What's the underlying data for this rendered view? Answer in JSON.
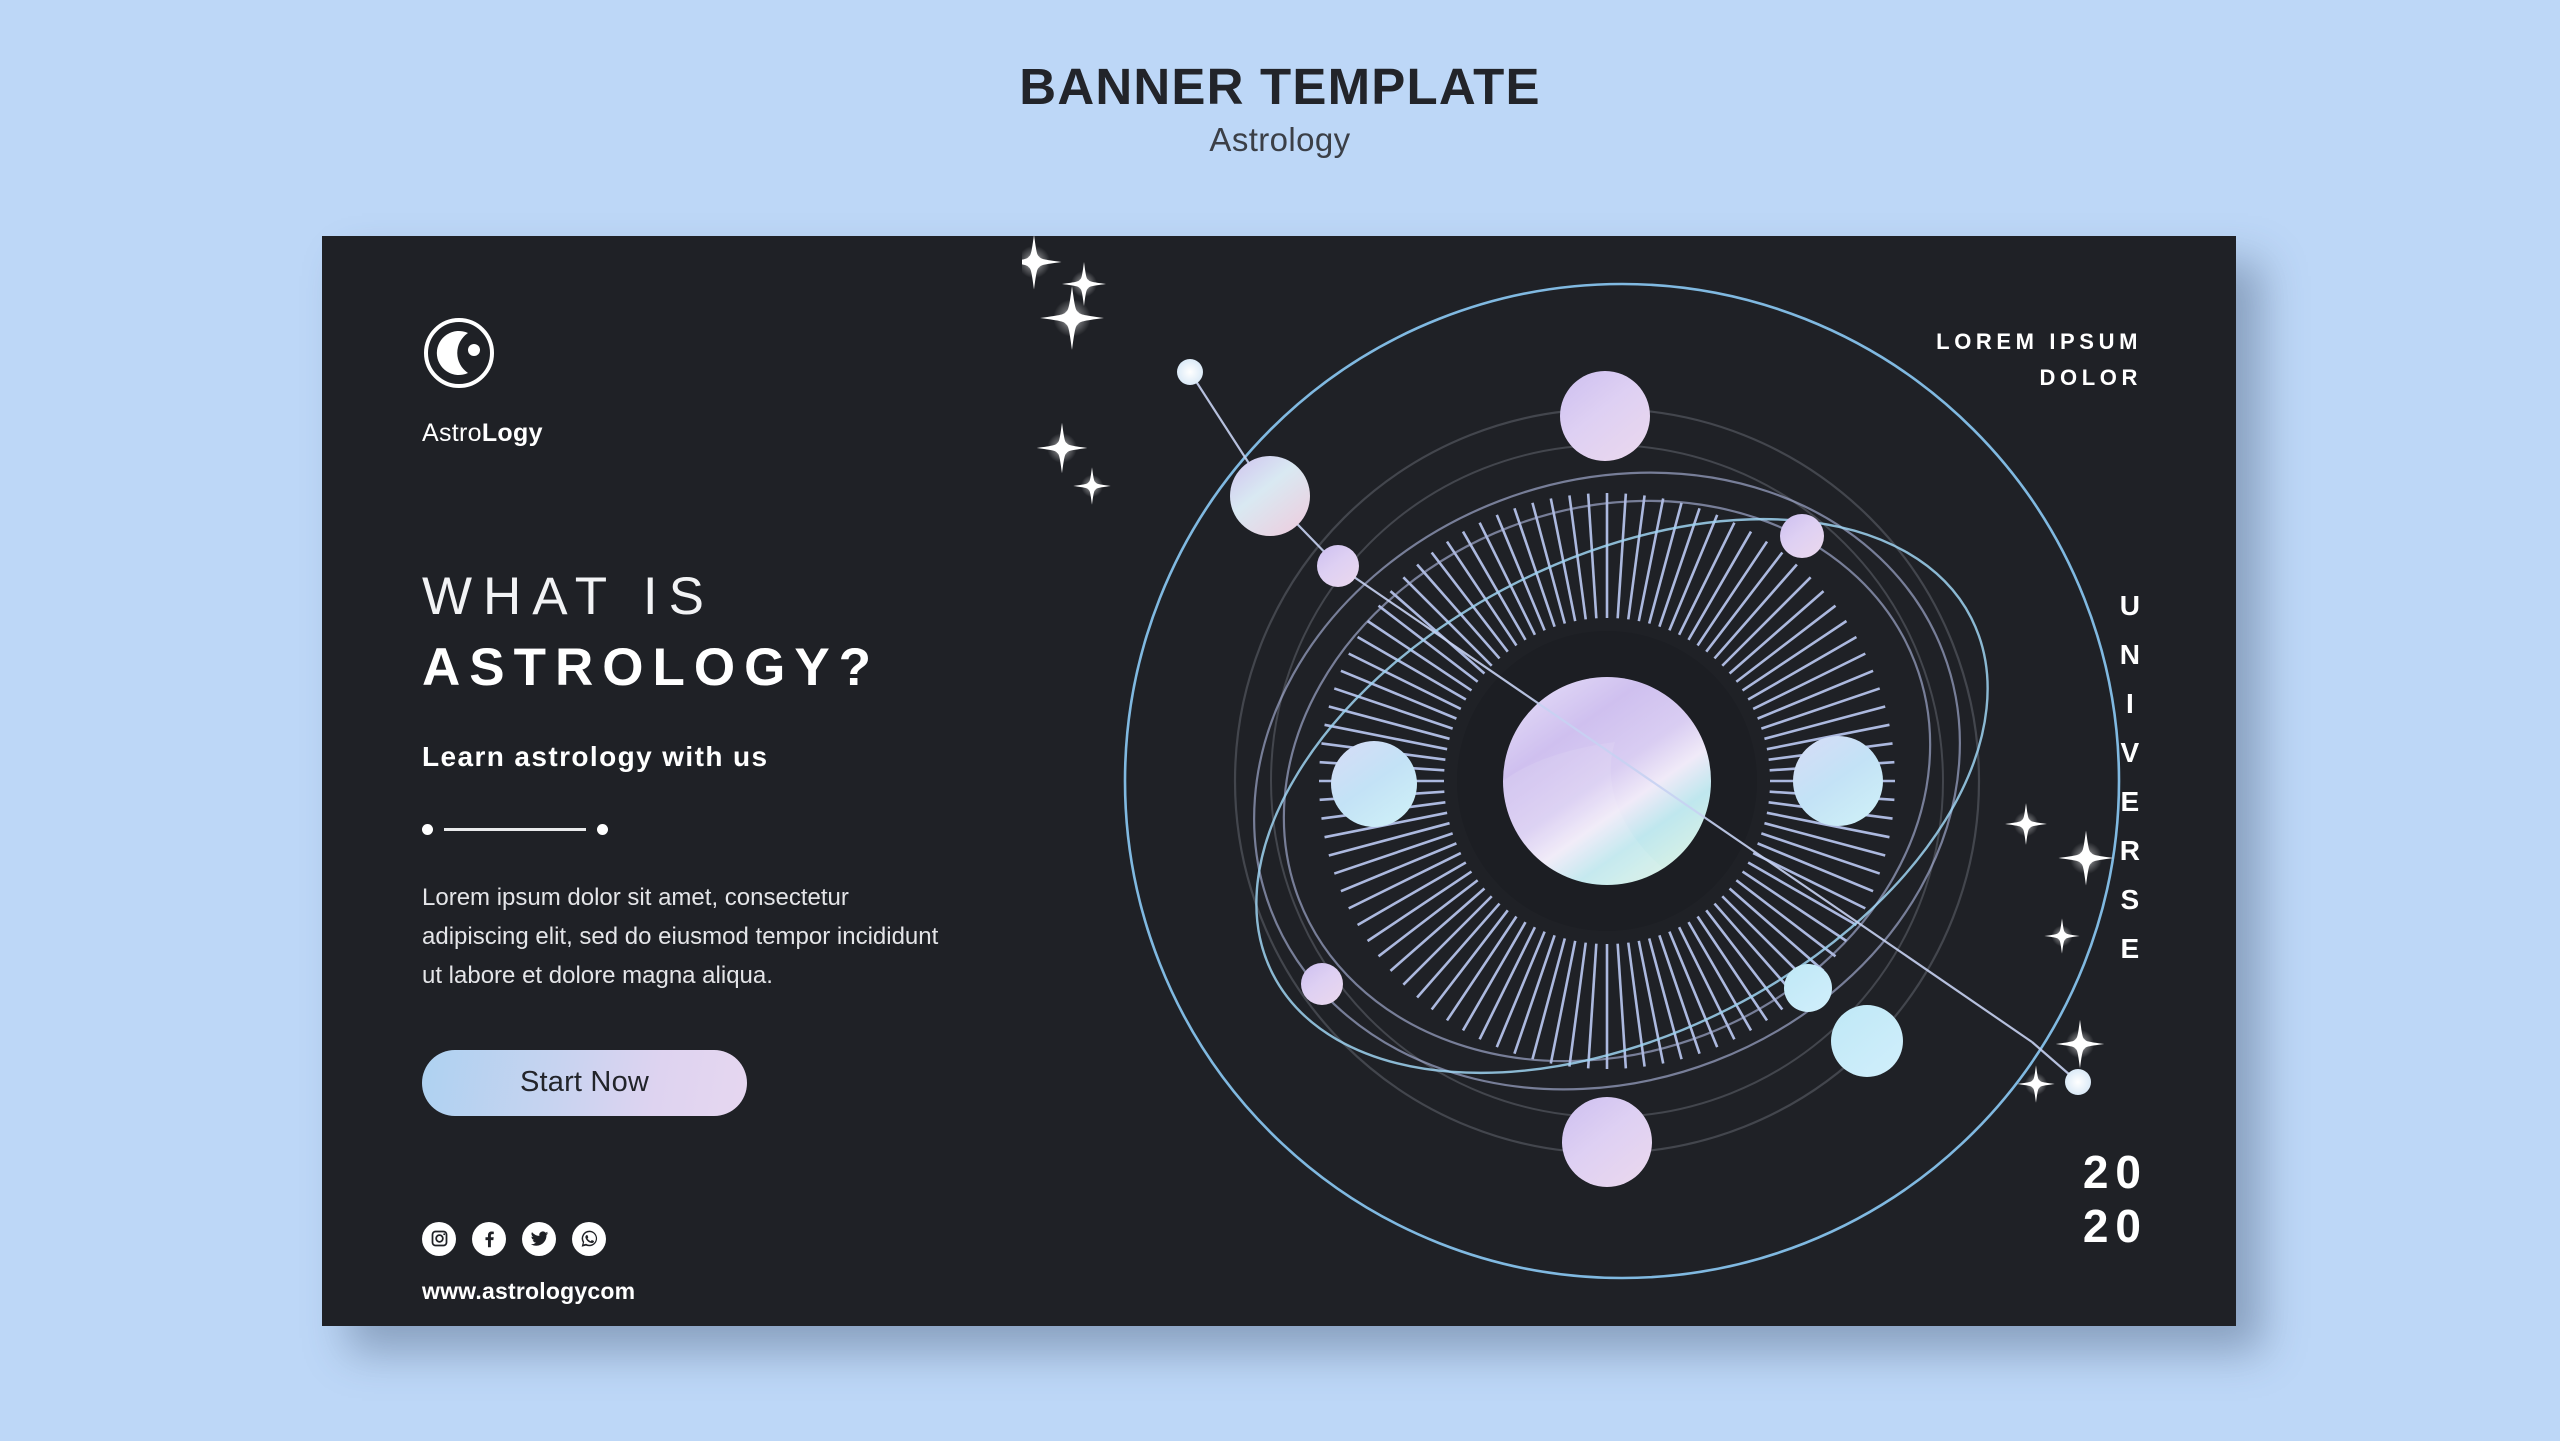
{
  "header": {
    "title": "BANNER TEMPLATE",
    "subtitle": "Astrology"
  },
  "banner": {
    "background_color": "#1f2126",
    "page_background_color": "#bdd7f7",
    "logo": {
      "icon": "crescent-moon-in-circle-icon",
      "name_light": "Astro",
      "name_bold": "Logy"
    },
    "headline": {
      "line1": "WHAT IS",
      "line2": "ASTROLOGY?"
    },
    "subheading": "Learn astrology with us",
    "body": "Lorem ipsum dolor sit amet, consectetur adipiscing elit, sed do eiusmod tempor  incididunt ut labore et dolore magna aliqua.",
    "cta": {
      "label": "Start Now",
      "gradient_start": "#aed2f1",
      "gradient_end": "#e6d7f0"
    },
    "socials": [
      {
        "name": "instagram",
        "label": "Instagram"
      },
      {
        "name": "facebook",
        "label": "Facebook"
      },
      {
        "name": "twitter",
        "label": "Twitter"
      },
      {
        "name": "whatsapp",
        "label": "WhatsApp"
      }
    ],
    "website": "www.astrologycom",
    "corner_text": {
      "line1": "LOREM IPSUM",
      "line2": "DOLOR"
    },
    "vertical_text": "UNIVERSE",
    "year": {
      "line1": "20",
      "line2": "20"
    }
  },
  "artwork": {
    "description": "solar-system-illustration",
    "center_planet_colors": [
      "#d8c9f2",
      "#c3e8f0",
      "#e2f5e0"
    ],
    "orbit_color": "#8ec3ea",
    "ray_color": "#b9c6ef"
  }
}
